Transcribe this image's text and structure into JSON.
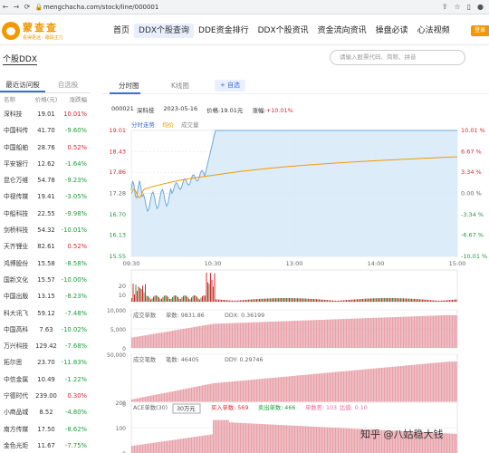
{
  "browser": {
    "url": "mengchacha.com/stock/line/000001"
  },
  "site": {
    "logo_name": "蒙查查",
    "logo_slogan": "看得更远 · 跟踪主力",
    "nav": [
      "首页",
      "DDX个股查询",
      "DDE资金排行",
      "DDX个股资讯",
      "资金流向资讯",
      "操盘必读",
      "心法视频"
    ],
    "nav_active_index": 1,
    "page_title": "个股DDX",
    "search_placeholder": "请输入股票代码、简称、拼音"
  },
  "sidebar": {
    "tabs": [
      "最近访问股",
      "自选股"
    ],
    "headers": [
      "名称",
      "价格(元)",
      "涨跌幅"
    ],
    "rows": [
      {
        "name": "深科技",
        "price": "19.01",
        "change": "10.01%",
        "dir": "up"
      },
      {
        "name": "中国科传",
        "price": "41.70",
        "change": "-9.60%",
        "dir": "down"
      },
      {
        "name": "中国船舶",
        "price": "28.76",
        "change": "0.52%",
        "dir": "up"
      },
      {
        "name": "平安银行",
        "price": "12.62",
        "change": "-1.64%",
        "dir": "down"
      },
      {
        "name": "昆仑万维",
        "price": "54.78",
        "change": "-9.23%",
        "dir": "down"
      },
      {
        "name": "中视传媒",
        "price": "19.41",
        "change": "-3.05%",
        "dir": "down"
      },
      {
        "name": "中船科技",
        "price": "22.55",
        "change": "-9.98%",
        "dir": "down"
      },
      {
        "name": "剑桥科技",
        "price": "54.32",
        "change": "-10.01%",
        "dir": "down"
      },
      {
        "name": "天齐锂业",
        "price": "82.61",
        "change": "0.52%",
        "dir": "up"
      },
      {
        "name": "鸿博股份",
        "price": "15.58",
        "change": "-8.58%",
        "dir": "down"
      },
      {
        "name": "国新文化",
        "price": "15.57",
        "change": "-10.00%",
        "dir": "down"
      },
      {
        "name": "中国出版",
        "price": "13.15",
        "change": "-8.23%",
        "dir": "down"
      },
      {
        "name": "科大讯飞",
        "price": "59.12",
        "change": "-7.48%",
        "dir": "down"
      },
      {
        "name": "中国高科",
        "price": "7.63",
        "change": "-10.02%",
        "dir": "down"
      },
      {
        "name": "万兴科技",
        "price": "129.42",
        "change": "-7.68%",
        "dir": "down"
      },
      {
        "name": "拓尔思",
        "price": "23.70",
        "change": "-11.83%",
        "dir": "down"
      },
      {
        "name": "中信金属",
        "price": "10.49",
        "change": "-1.22%",
        "dir": "down"
      },
      {
        "name": "宁德时代",
        "price": "239.00",
        "change": "0.30%",
        "dir": "up"
      },
      {
        "name": "小商品城",
        "price": "8.52",
        "change": "-4.80%",
        "dir": "down"
      },
      {
        "name": "南方传媒",
        "price": "17.50",
        "change": "-8.62%",
        "dir": "down"
      },
      {
        "name": "金色光炬",
        "price": "11.67",
        "change": "-7.75%",
        "dir": "down"
      }
    ]
  },
  "main": {
    "tabs": [
      "分时图",
      "K线图"
    ],
    "add_label": "+ 自选",
    "code": "000021",
    "name": "深科技",
    "date": "2023-05-16",
    "price_label": "价格:19.01元",
    "change_label": "涨幅:",
    "change_value": "+10.01%",
    "chart_tabs": [
      "分时走势",
      "均价",
      "成交量"
    ],
    "y_left": [
      "19.01",
      "18.43",
      "17.86",
      "17.28",
      "16.70",
      "16.13",
      "15.55"
    ],
    "y_right": [
      "10.01 %",
      "6.67 %",
      "3.34 %",
      "0.00 %",
      "-3.34 %",
      "-6.67 %",
      "-10.01 %"
    ],
    "x_ticks": [
      "09:30",
      "10:30",
      "13:00",
      "14:00",
      "15:00"
    ],
    "vol_y": [
      "20",
      "10"
    ],
    "panel1": {
      "label": "成交单数",
      "sub": "单数: 9831.86",
      "ddx": "DDX: 0.36199",
      "y": [
        "10,000",
        "5,000",
        "0"
      ]
    },
    "panel2": {
      "label": "成交笔数",
      "sub": "笔数: 46405",
      "ddy": "DDY: 0.29746",
      "y": [
        "50,000",
        "0"
      ]
    },
    "panel3": {
      "label": "ACE单数(30)",
      "select": "30万元",
      "buy": "买入单数: 569",
      "sell": "卖出单数: 466",
      "diff": "单数差: 103",
      "ratio": "比值: 0.10",
      "y": [
        "200",
        "100",
        "0"
      ]
    }
  },
  "watermark": "知乎 @八姑稳大钱",
  "chart_data": {
    "type": "line",
    "x_ticks": [
      "09:30",
      "10:30",
      "13:00",
      "14:00",
      "15:00"
    ],
    "series": [
      {
        "name": "分时走势",
        "values_approx": [
          17.28,
          17.4,
          17.0,
          17.3,
          17.6,
          17.8,
          18.2,
          19.01,
          19.01,
          19.01,
          19.01,
          19.01
        ]
      },
      {
        "name": "均价",
        "values_approx": [
          17.28,
          17.5,
          17.7,
          17.8,
          17.9,
          18.0,
          18.1,
          18.2,
          18.25,
          18.3,
          18.3,
          18.35
        ]
      }
    ],
    "ylim": [
      15.55,
      19.01
    ]
  }
}
